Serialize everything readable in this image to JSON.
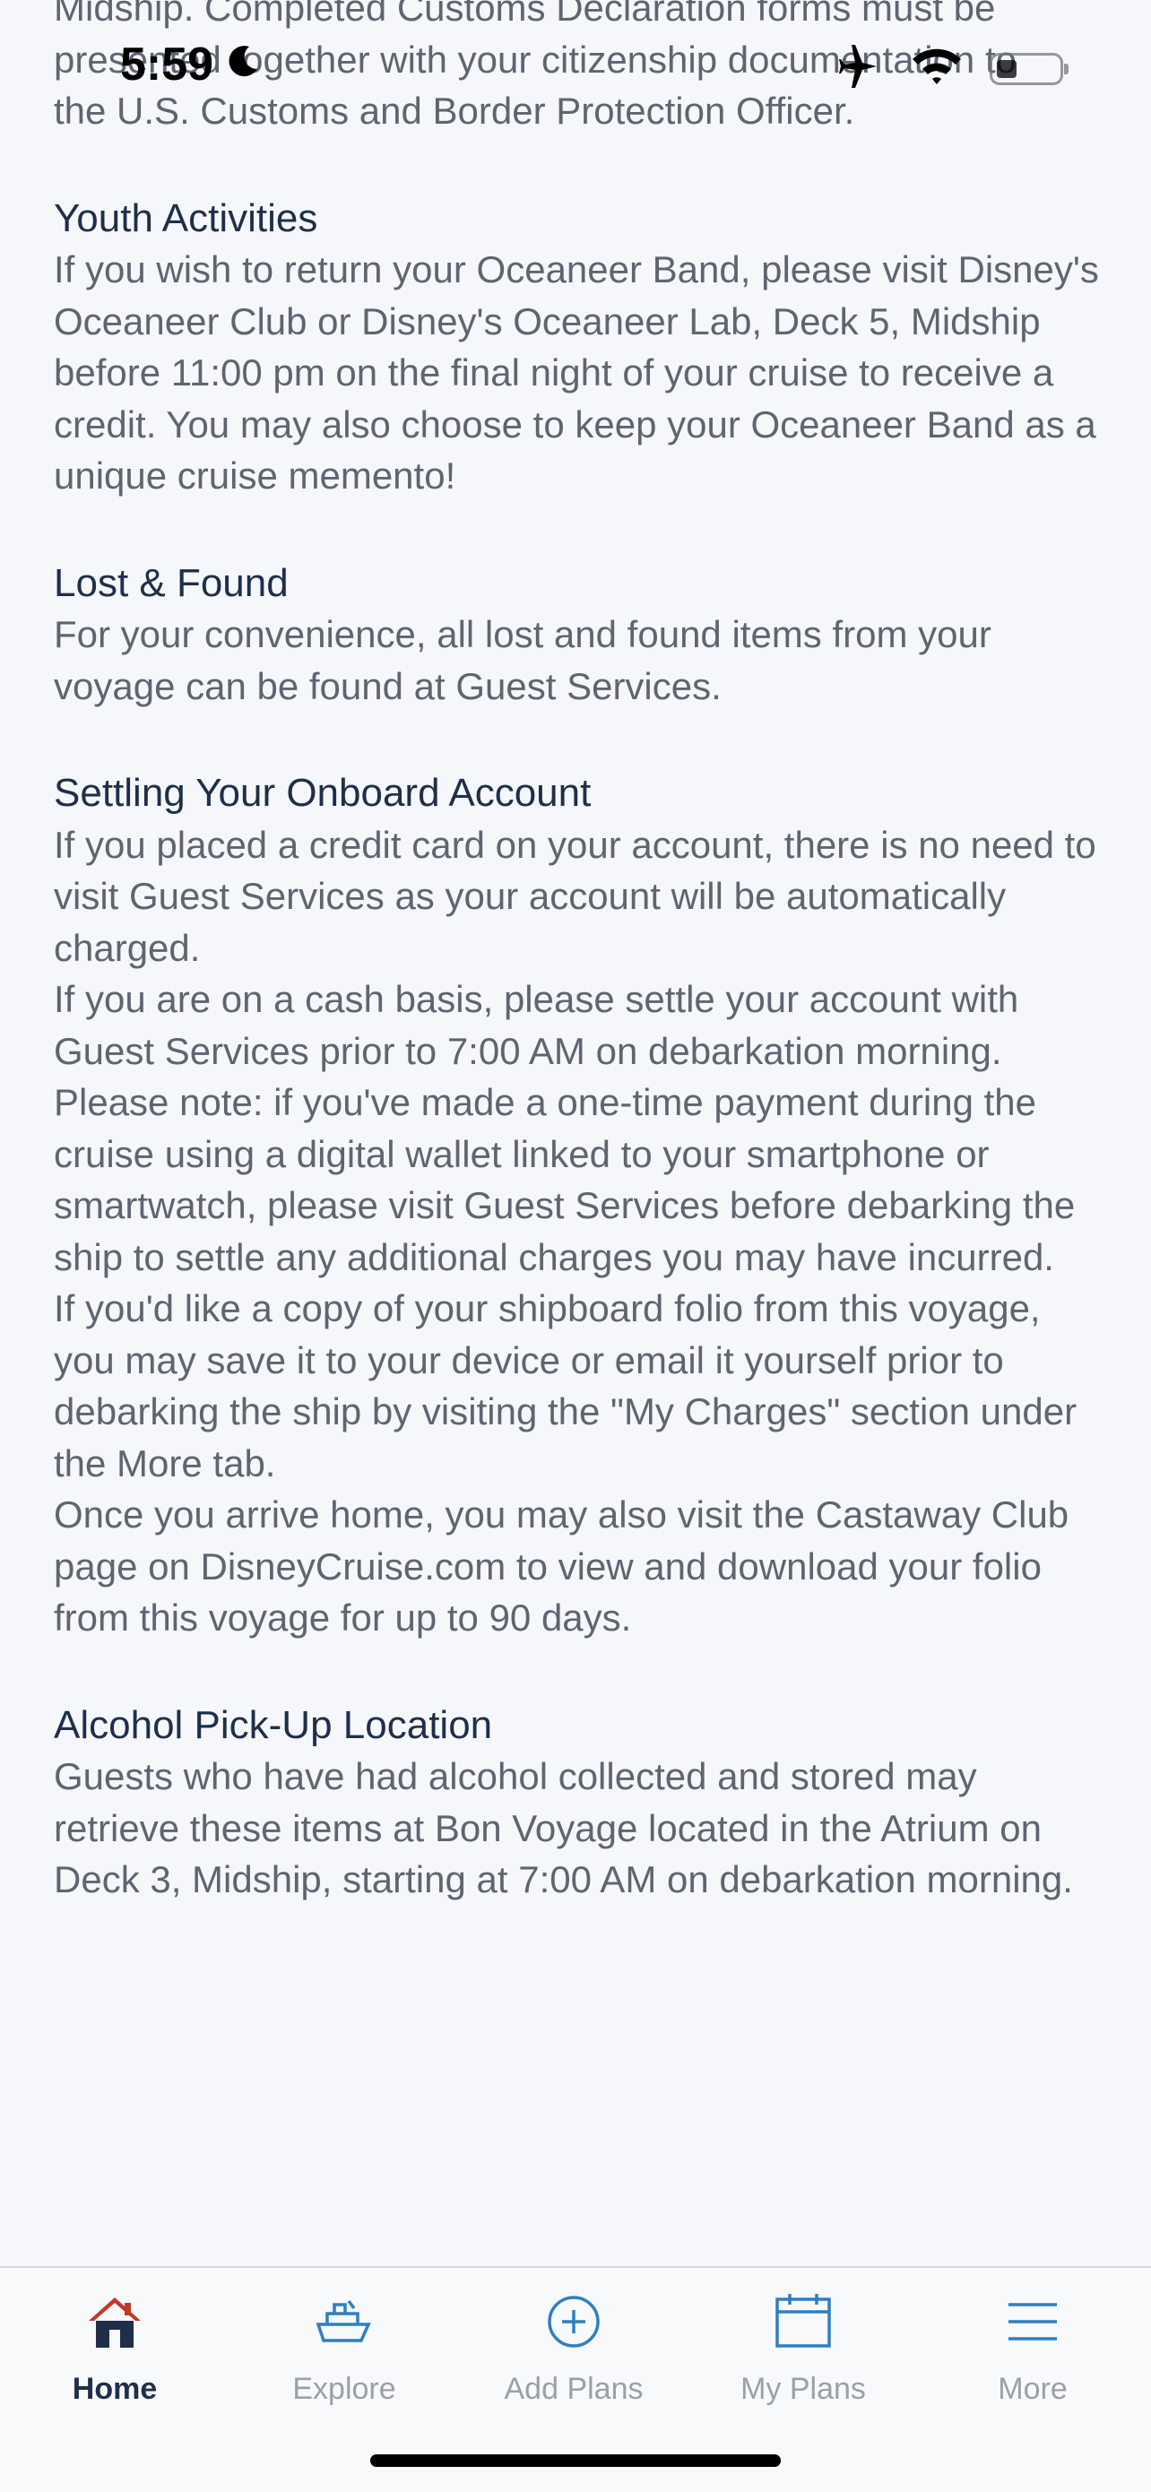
{
  "status_bar": {
    "time": "5:59"
  },
  "content": {
    "intro_lines": [
      "Midship. Completed Customs Declaration forms must be",
      "presented together with your citizenship documentation to",
      "the U.S. Customs and Border Protection Officer."
    ],
    "sections": [
      {
        "title": "Youth Activities",
        "paragraphs": [
          "If you wish to return your Oceaneer Band, please visit Disney's Oceaneer Club or Disney's Oceaneer Lab, Deck 5, Midship before 11:00 pm on the final night of your cruise to receive a credit. You may also choose to keep your Oceaneer Band as a unique cruise memento!"
        ]
      },
      {
        "title": "Lost & Found",
        "paragraphs": [
          "For your convenience, all lost and found items from your voyage can be found at Guest Services."
        ]
      },
      {
        "title": "Settling Your Onboard Account",
        "paragraphs": [
          "If you placed a credit card on your account, there is no need to visit Guest Services as your account will be automatically charged.",
          "If you are on a cash basis, please settle your account with Guest Services prior to 7:00 AM on debarkation morning. Please note: if you've made a one-time payment during the cruise using a digital wallet linked to your smartphone or smartwatch, please visit Guest Services before debarking the ship to settle any additional charges you may have incurred.",
          "If you'd like a copy of your shipboard folio from this voyage, you may save it to your device or email it yourself prior to debarking the ship by visiting the \"My Charges\" section under the More tab.",
          "Once you arrive home, you may also visit the Castaway Club page on DisneyCruise.com to view and download your folio from this voyage for up to 90 days."
        ]
      },
      {
        "title": "Alcohol Pick-Up Location",
        "paragraphs": [
          "Guests who have had alcohol collected and stored may retrieve these items at Bon Voyage located in the Atrium on Deck 3, Midship, starting at 7:00 AM on debarkation morning."
        ]
      }
    ]
  },
  "tab_bar": {
    "active_color": "#1f2f49",
    "inactive_color": "#9aa0aa",
    "icon_color": "#2f7fc1",
    "home_icon_roof_color": "#c0392b",
    "tabs": [
      {
        "label": "Home",
        "icon": "home-icon",
        "active": true
      },
      {
        "label": "Explore",
        "icon": "ship-icon",
        "active": false
      },
      {
        "label": "Add Plans",
        "icon": "plus-circle-icon",
        "active": false
      },
      {
        "label": "My Plans",
        "icon": "calendar-icon",
        "active": false
      },
      {
        "label": "More",
        "icon": "menu-icon",
        "active": false
      }
    ]
  }
}
